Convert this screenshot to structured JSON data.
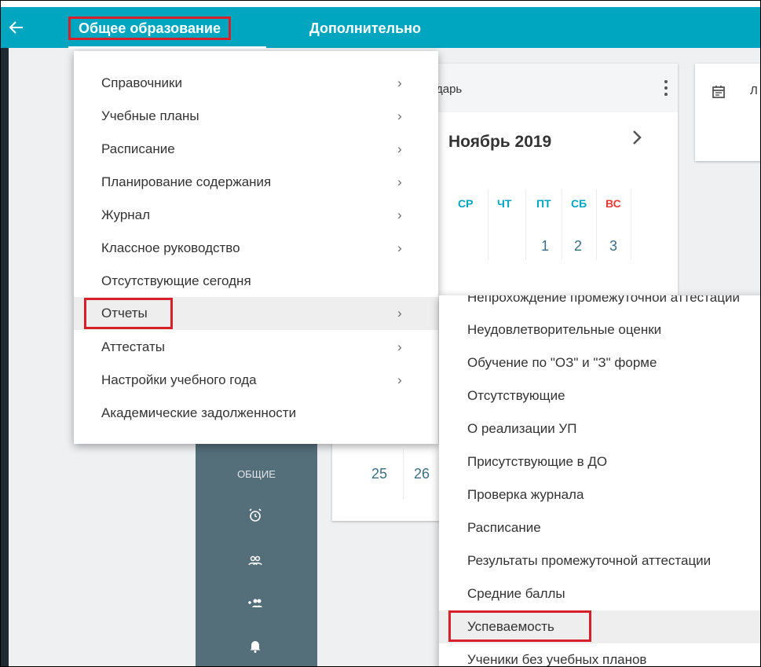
{
  "topbar": {
    "tab_general": "Общее образование",
    "tab_extra": "Дополнительно"
  },
  "calendar": {
    "title": "дарь",
    "month": "Ноябрь 2019",
    "weekdays": [
      "СР",
      "ЧТ",
      "ПТ",
      "СБ",
      "ВС"
    ],
    "days_row1": [
      "1",
      "2",
      "3"
    ],
    "days_row_last": [
      "25",
      "26"
    ]
  },
  "card2": {
    "text": "Л"
  },
  "sidebar_dark": {
    "label": "ОБЩИЕ"
  },
  "menu": {
    "items": [
      {
        "label": "Справочники",
        "arrow": "›"
      },
      {
        "label": "Учебные планы",
        "arrow": "›"
      },
      {
        "label": "Расписание",
        "arrow": "›"
      },
      {
        "label": "Планирование содержания",
        "arrow": "›"
      },
      {
        "label": "Журнал",
        "arrow": "›"
      },
      {
        "label": "Классное руководство",
        "arrow": "›"
      },
      {
        "label": "Отсутствующие сегодня",
        "arrow": ""
      },
      {
        "label": "Отчеты",
        "arrow": "›"
      },
      {
        "label": "Аттестаты",
        "arrow": "›"
      },
      {
        "label": "Настройки учебного года",
        "arrow": "›"
      },
      {
        "label": "Академические задолженности",
        "arrow": ""
      }
    ]
  },
  "submenu": {
    "items": [
      {
        "label": "Непрохождение промежуточной аттестации"
      },
      {
        "label": "Неудовлетворительные оценки"
      },
      {
        "label": "Обучение по \"ОЗ\" и \"З\" форме"
      },
      {
        "label": "Отсутствующие"
      },
      {
        "label": "О реализации УП"
      },
      {
        "label": "Присутствующие в ДО"
      },
      {
        "label": "Проверка журнала"
      },
      {
        "label": "Расписание"
      },
      {
        "label": "Результаты промежуточной аттестации"
      },
      {
        "label": "Средние баллы"
      },
      {
        "label": "Успеваемость"
      },
      {
        "label": "Ученики без учебных планов"
      }
    ]
  },
  "colors": {
    "topbar": "#00a5c0",
    "highlight_box": "#d6202a",
    "dark_nav": "#546e7a",
    "sunday": "#e53935"
  }
}
